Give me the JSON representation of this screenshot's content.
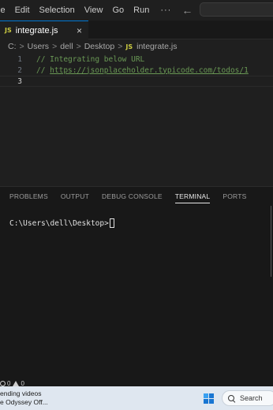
{
  "menu": {
    "items": [
      "le",
      "Edit",
      "Selection",
      "View",
      "Go",
      "Run"
    ],
    "more": "···",
    "back": "←",
    "forward": "→"
  },
  "tab": {
    "icon": "JS",
    "name": "integrate.js",
    "close": "×"
  },
  "breadcrumb": {
    "items": [
      "C:",
      "Users",
      "dell",
      "Desktop",
      "integrate.js"
    ],
    "separator": ">",
    "file_icon": "JS"
  },
  "editor": {
    "lines": [
      {
        "number": "1",
        "text": "// Integrating below URL"
      },
      {
        "number": "2",
        "prefix": "// ",
        "link": "https://jsonplaceholder.typicode.com/todos/1"
      },
      {
        "number": "3",
        "text": ""
      }
    ]
  },
  "panel": {
    "tabs": [
      "PROBLEMS",
      "OUTPUT",
      "DEBUG CONSOLE",
      "TERMINAL",
      "PORTS"
    ],
    "active_tab": "TERMINAL",
    "terminal_prompt": "C:\\Users\\dell\\Desktop>"
  },
  "status": {
    "errors": "0",
    "warnings": "0"
  },
  "taskbar": {
    "news_line1": "ending videos",
    "news_line2": "e Odyssey Off...",
    "search_label": "Search"
  },
  "colors": {
    "accent": "#0078d4",
    "comment": "#6a9955",
    "js_badge": "#cbcb41"
  }
}
